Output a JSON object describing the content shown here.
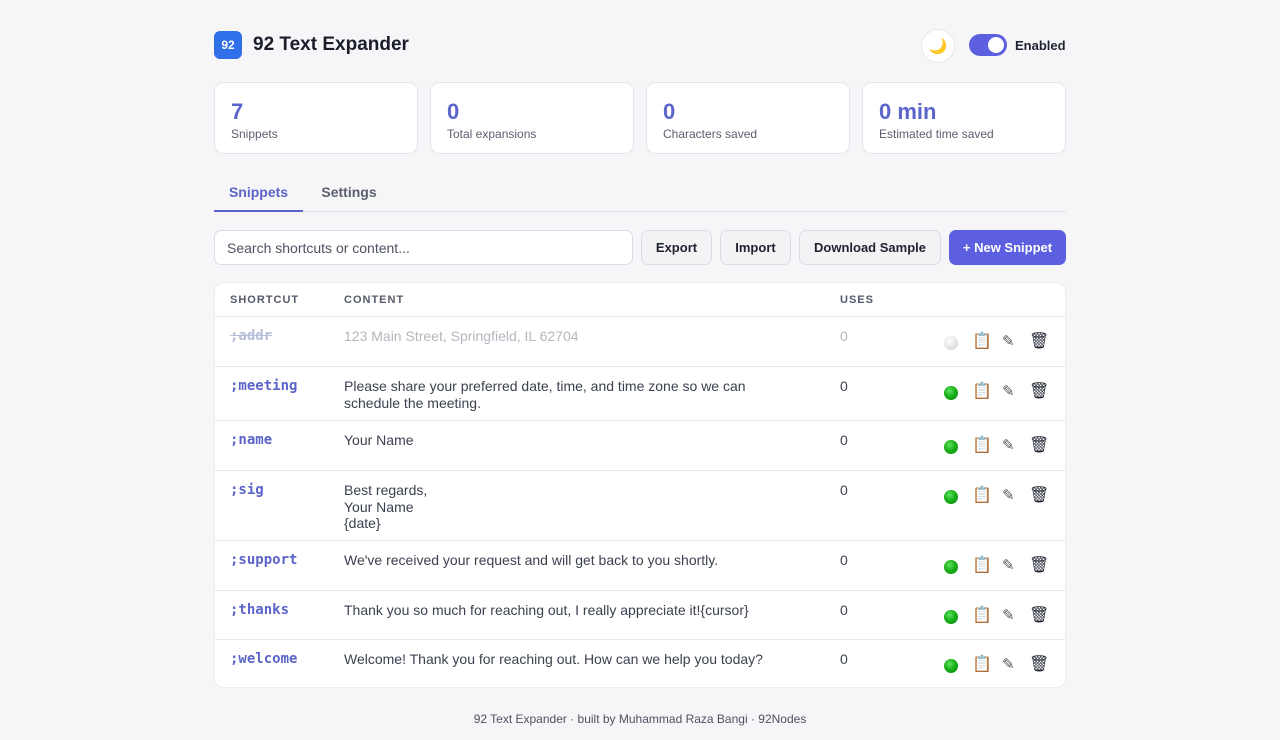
{
  "header": {
    "logo_text": "92",
    "title": "92 Text Expander",
    "theme_icon": "🌙",
    "toggle_label": "Enabled"
  },
  "stats": [
    {
      "value": "7",
      "label": "Snippets"
    },
    {
      "value": "0",
      "label": "Total expansions"
    },
    {
      "value": "0",
      "label": "Characters saved"
    },
    {
      "value": "0 min",
      "label": "Estimated time saved"
    }
  ],
  "tabs": [
    {
      "label": "Snippets",
      "active": true
    },
    {
      "label": "Settings",
      "active": false
    }
  ],
  "toolbar": {
    "search_placeholder": "Search shortcuts or content...",
    "export_label": "Export",
    "import_label": "Import",
    "download_label": "Download Sample",
    "new_label": "+ New Snippet"
  },
  "table": {
    "headers": {
      "shortcut": "SHORTCUT",
      "content": "CONTENT",
      "uses": "USES"
    },
    "icons": {
      "copy": "📋",
      "edit": "✎",
      "delete": "🗑"
    },
    "rows": [
      {
        "shortcut": ";addr",
        "content": "123 Main Street, Springfield, IL 62704",
        "uses": "0",
        "enabled": false
      },
      {
        "shortcut": ";meeting",
        "content": "Please share your preferred date, time, and time zone so we can schedule the meeting.",
        "uses": "0",
        "enabled": true
      },
      {
        "shortcut": ";name",
        "content": "Your Name",
        "uses": "0",
        "enabled": true
      },
      {
        "shortcut": ";sig",
        "content": "Best regards,\nYour Name\n{date}",
        "uses": "0",
        "enabled": true
      },
      {
        "shortcut": ";support",
        "content": "We've received your request and will get back to you shortly.",
        "uses": "0",
        "enabled": true
      },
      {
        "shortcut": ";thanks",
        "content": "Thank you so much for reaching out, I really appreciate it!{cursor}",
        "uses": "0",
        "enabled": true
      },
      {
        "shortcut": ";welcome",
        "content": "Welcome! Thank you for reaching out. How can we help you today?",
        "uses": "0",
        "enabled": true
      }
    ]
  },
  "footer": "92 Text Expander · built by Muhammad Raza Bangi · 92Nodes",
  "colors": {
    "accent": "#5b64c8",
    "primary_button": "#5b5fe0",
    "logo": "#2f6fe8",
    "enabled_dot": "#19b019"
  }
}
